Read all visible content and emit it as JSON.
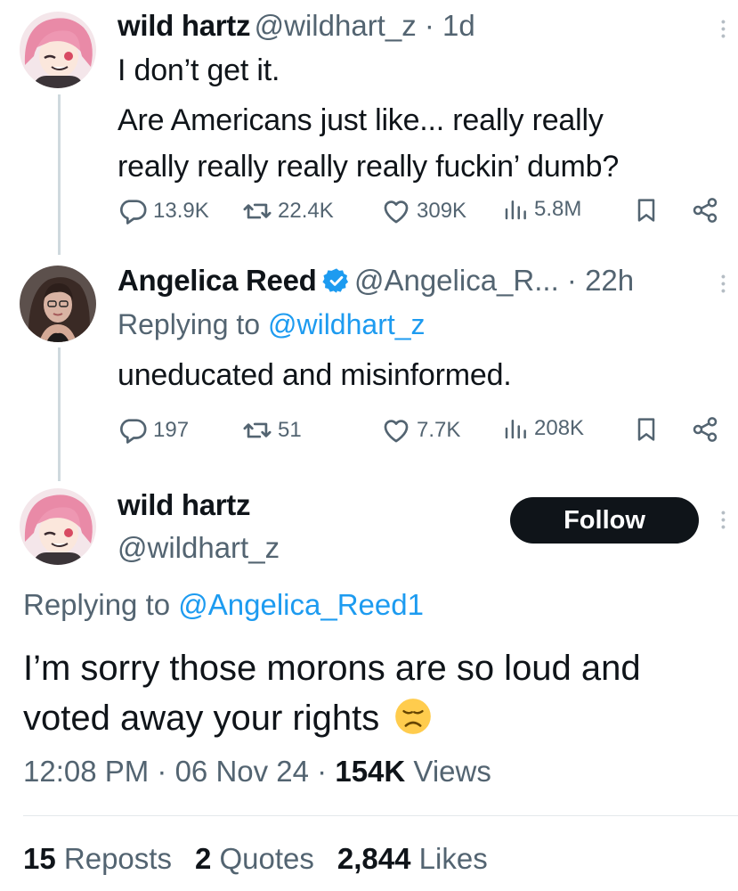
{
  "tweet1": {
    "name": "wild hartz",
    "handle": "@wildhart_z",
    "time": "1d",
    "lines": [
      "I don’t get it.",
      "Are Americans just like... really really",
      "really really really really fuckin’ dumb?"
    ],
    "replies": "13.9K",
    "reposts": "22.4K",
    "likes": "309K",
    "views": "5.8M"
  },
  "tweet2": {
    "name": "Angelica Reed",
    "handle": "@Angelica_R...",
    "time": "22h",
    "replying_prefix": "Replying to ",
    "replying_to": "@wildhart_z",
    "text": "uneducated and misinformed.",
    "replies": "197",
    "reposts": "51",
    "likes": "7.7K",
    "views": "208K"
  },
  "main": {
    "name": "wild hartz",
    "handle": "@wildhart_z",
    "follow_label": "Follow",
    "replying_prefix": "Replying to ",
    "replying_to": "@Angelica_Reed1",
    "line1": "I’m sorry those morons are so loud and",
    "line2": "voted away your rights",
    "time": "12:08 PM",
    "date": "06 Nov 24",
    "views_count": "154K",
    "views_label": "Views",
    "reposts_count": "15",
    "reposts_label": "Reposts",
    "quotes_count": "2",
    "quotes_label": "Quotes",
    "likes_count": "2,844",
    "likes_label": "Likes"
  },
  "icons": {
    "reply": "reply-icon",
    "repost": "repost-icon",
    "like": "heart-icon",
    "views": "views-icon",
    "bookmark": "bookmark-icon",
    "share": "share-icon",
    "more": "more-icon",
    "verified": "verified-badge-icon",
    "emoji": "disappointed-face-emoji"
  },
  "colors": {
    "text": "#0f1419",
    "secondary": "#536471",
    "link": "#1d9bf0",
    "verified": "#1d9bf0",
    "follow_bg": "#0f1419"
  }
}
